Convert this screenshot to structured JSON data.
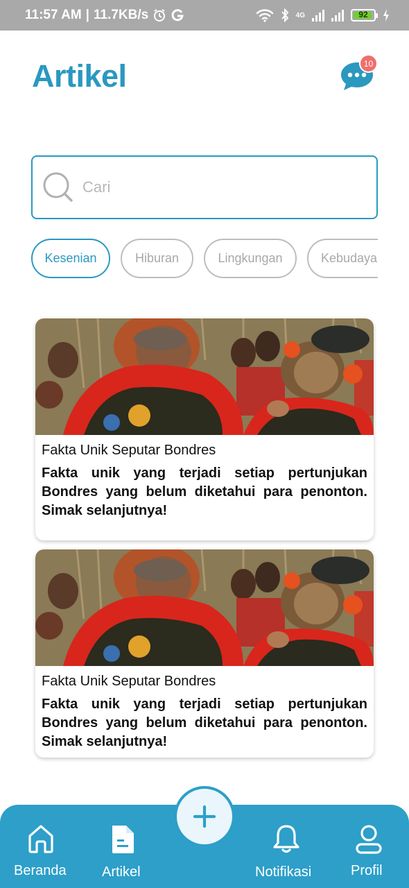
{
  "status_bar": {
    "time": "11:57 AM",
    "separator": "|",
    "speed": "11.7KB/s",
    "network": "4G",
    "battery": "92"
  },
  "header": {
    "title": "Artikel",
    "chat_badge": "10"
  },
  "search": {
    "placeholder": "Cari"
  },
  "categories": [
    {
      "label": "Kesenian",
      "active": true
    },
    {
      "label": "Hiburan",
      "active": false
    },
    {
      "label": "Lingkungan",
      "active": false
    },
    {
      "label": "Kebudayaan",
      "active": false
    }
  ],
  "articles": [
    {
      "title": "Fakta Unik Seputar Bondres",
      "description": "Fakta unik yang terjadi setiap pertunjukan Bondres yang belum diketahui para penonton. Simak selanjutnya!"
    },
    {
      "title": "Fakta Unik Seputar Bondres",
      "description": "Fakta unik yang terjadi setiap pertunjukan Bondres yang belum diketahui para penonton. Simak selanjutnya!"
    }
  ],
  "bottom_nav": {
    "home": "Beranda",
    "articles": "Artikel",
    "notifications": "Notifikasi",
    "profile": "Profil"
  },
  "colors": {
    "accent": "#2b98c0",
    "nav_background": "#2d9fc9",
    "badge": "#ef6f6c"
  }
}
